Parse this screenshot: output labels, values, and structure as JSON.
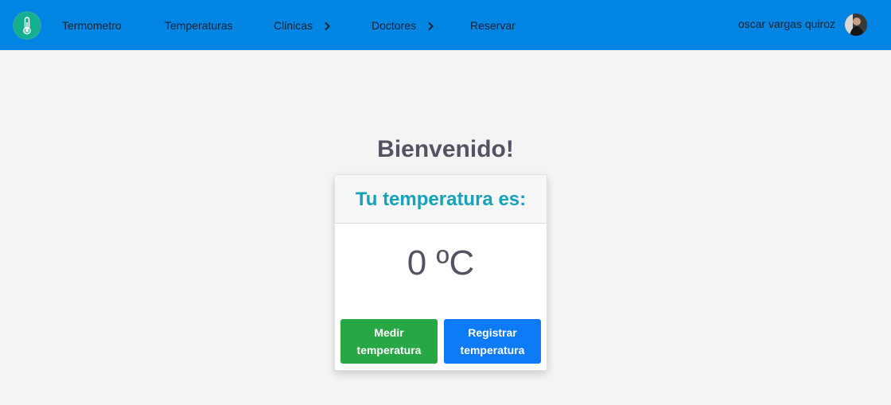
{
  "navbar": {
    "logo_icon": "thermometer-icon",
    "items": [
      {
        "label": "Termometro",
        "has_chevron": false
      },
      {
        "label": "Temperaturas",
        "has_chevron": false
      },
      {
        "label": "Clinicas",
        "has_chevron": true
      },
      {
        "label": "Doctores",
        "has_chevron": true
      },
      {
        "label": "Reservar",
        "has_chevron": false
      }
    ],
    "user_name": "oscar vargas quiroz",
    "avatar_icon": "user-avatar"
  },
  "main": {
    "welcome": "Bienvenido!",
    "card": {
      "header": "Tu temperatura es:",
      "value": "0 ºC",
      "buttons": {
        "measure": "Medir\ntemperatura",
        "register": "Registrar\ntemperatura"
      }
    }
  },
  "colors": {
    "navbar": "#0185e3",
    "accent_header": "#17a2b8",
    "measure_button": "#28a745",
    "register_button": "#0d7bf5"
  }
}
